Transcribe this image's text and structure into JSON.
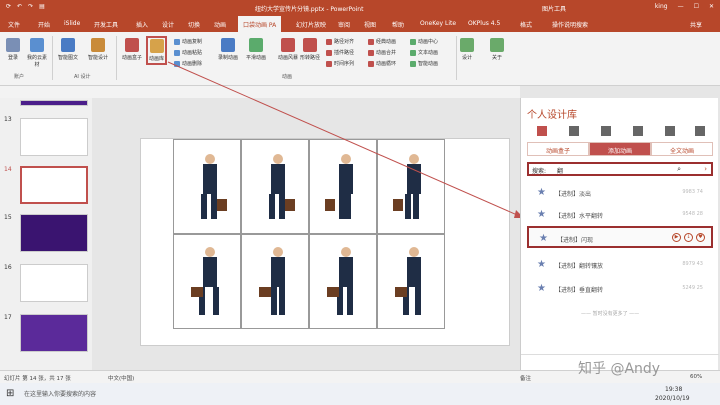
{
  "titlebar": {
    "qa": [
      "⟳",
      "↶",
      "↷",
      "▤"
    ],
    "title": "纽约大学宣传片分镜.pptx  -  PowerPoint",
    "pic": "图片工具",
    "user": "king",
    "min": "—",
    "max": "☐",
    "close": "✕"
  },
  "tabs": [
    "文件",
    "开始",
    "iSlide",
    "开发工具",
    "插入",
    "设计",
    "切换",
    "动画",
    "口袋动画 PA",
    "幻灯片放映",
    "审阅",
    "视图",
    "帮助",
    "OneKey Lite",
    "OKPlus 4.5",
    "格式",
    "操作说明搜索",
    "共享"
  ],
  "ribbon": {
    "btns": [
      "登录",
      "我的云素材",
      "智能图文",
      "智能设计",
      "动画盒子",
      "动画库",
      "录制动画",
      "平滑动画",
      "动画风暴",
      "形转路径",
      "设计",
      "关于"
    ],
    "small": [
      "动画复制",
      "动画粘贴",
      "动画删除",
      "路径对齐",
      "插件路径",
      "时间序列",
      "经典动画",
      "动画合并",
      "动画循环",
      "动画中心",
      "文本动画",
      "智能动画"
    ],
    "groups": [
      "账户",
      "AI 设计",
      "动画"
    ]
  },
  "thumbs": [
    "13",
    "14",
    "15",
    "16",
    "17"
  ],
  "status": {
    "left": "幻灯片 第 14 张，共 17 张",
    "lang": "中文(中国)",
    "notes": "备注",
    "zoom": "60%"
  },
  "panel": {
    "title": "个人设计库",
    "tabs": [
      "动画盒子",
      "添加动画",
      "全文动画"
    ],
    "search_label": "搜索:",
    "search_val": "翻",
    "items": [
      {
        "t": "【进制】淡出",
        "s": "9983  74"
      },
      {
        "t": "【进制】水平翻转",
        "s": "9548  28"
      },
      {
        "t": "【进制】闪现",
        "s": ""
      },
      {
        "t": "【进制】翻转镶放",
        "s": "8979  43"
      },
      {
        "t": "【进制】垂直翻转",
        "s": "5249  25"
      }
    ],
    "note": "—— 暂时没有更多了 ——"
  },
  "taskbar": {
    "search": "在这里输入你要搜索的内容",
    "time": "19:38",
    "date": "2020/10/19"
  },
  "watermark": "知乎 @Andy"
}
